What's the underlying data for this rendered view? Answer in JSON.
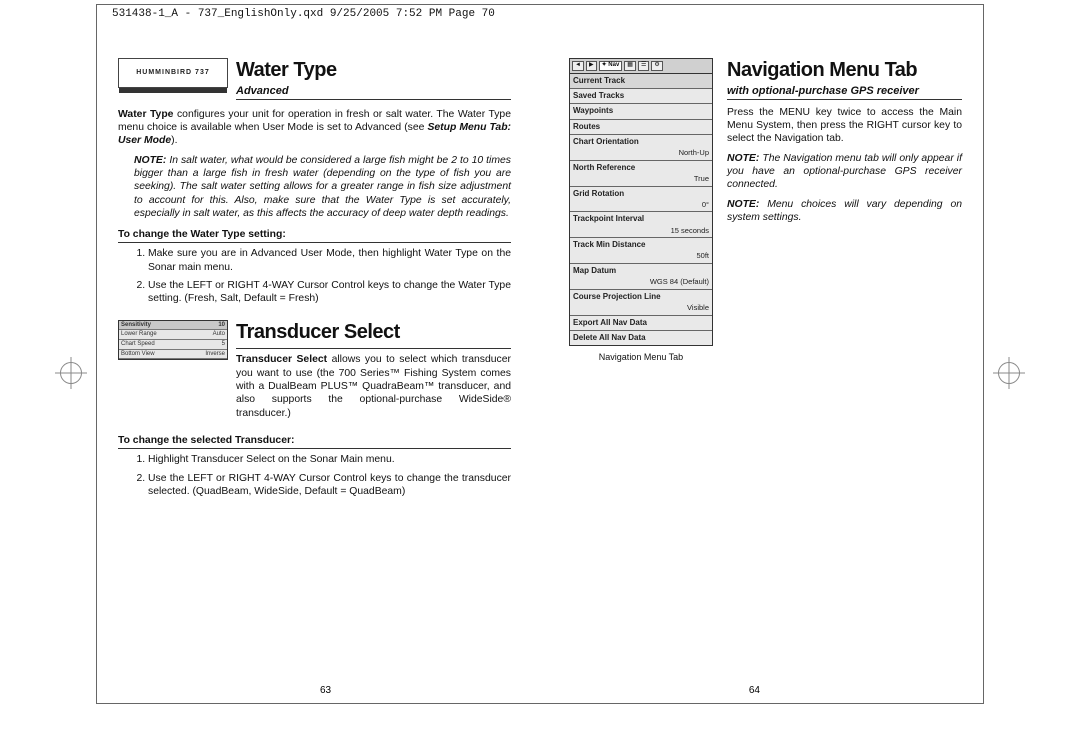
{
  "header_slug": "531438-1_A - 737_EnglishOnly.qxd  9/25/2005  7:52 PM  Page 70",
  "left": {
    "brand": "HUMMINBIRD 737",
    "section1": {
      "heading": "Water Type",
      "subhead": "Advanced",
      "intro_bold": "Water Type",
      "intro_rest": " configures your unit for operation in fresh or salt water. The Water Type menu choice is available when User Mode is set to Advanced (see ",
      "intro_ref": "Setup Menu Tab: User Mode",
      "intro_end": ").",
      "note_label": "NOTE:",
      "note_text": "  In salt water, what would be considered a large fish might be 2 to 10 times bigger than a large fish in fresh water (depending on the type of fish you are seeking).  The salt water setting allows for a greater range in fish size adjustment to account for this.  Also, make sure that the Water Type is set accurately, especially in salt water, as this affects the accuracy of deep water depth readings.",
      "instr_head": "To change the Water Type setting:",
      "steps": [
        "Make sure you are in Advanced User Mode, then highlight Water Type on the Sonar main menu.",
        "Use the LEFT or RIGHT 4-WAY Cursor Control keys to change the Water Type setting. (Fresh, Salt, Default = Fresh)"
      ]
    },
    "section2": {
      "heading": "Transducer Select",
      "menu_rows": [
        {
          "l": "Sensitivity",
          "r": "10"
        },
        {
          "l": "Lower Range",
          "r": "Auto"
        },
        {
          "l": "Chart Speed",
          "r": "5"
        },
        {
          "l": "Bottom View",
          "r": "Inverse"
        }
      ],
      "intro_bold": "Transducer Select",
      "intro_rest": " allows you to select which transducer you want to use (the 700 Series™ Fishing System comes with a DualBeam PLUS™ QuadraBeam™ transducer, and also supports the optional-purchase WideSide® transducer.)",
      "instr_head": "To change the selected Transducer:",
      "steps": [
        "Highlight Transducer Select on the Sonar Main menu.",
        "Use the LEFT or RIGHT 4-WAY Cursor Control keys to change the transducer selected. (QuadBeam, WideSide, Default = QuadBeam)"
      ]
    },
    "pagenum": "63"
  },
  "right": {
    "heading": "Navigation Menu Tab",
    "subhead": "with optional-purchase GPS receiver",
    "intro": "Press the MENU key twice to access the Main Menu System, then press the RIGHT cursor key to select the Navigation tab.",
    "note1_label": "NOTE:",
    "note1_text": " The Navigation menu tab will only appear if you have an optional-purchase GPS receiver connected.",
    "note2_label": "NOTE:",
    "note2_text": " Menu choices will vary depending on system settings.",
    "nav_tab_label": "✦ Nav",
    "nav_items": [
      {
        "label": "Current Track",
        "val": ""
      },
      {
        "label": "Saved Tracks",
        "val": ""
      },
      {
        "label": "Waypoints",
        "val": ""
      },
      {
        "label": "Routes",
        "val": ""
      },
      {
        "label": "Chart Orientation",
        "val": "North-Up"
      },
      {
        "label": "North Reference",
        "val": "True"
      },
      {
        "label": "Grid Rotation",
        "val": "0°"
      },
      {
        "label": "Trackpoint Interval",
        "val": "15 seconds"
      },
      {
        "label": "Track Min Distance",
        "val": "50ft"
      },
      {
        "label": "Map Datum",
        "val": "WGS 84 (Default)"
      },
      {
        "label": "Course Projection Line",
        "val": "Visible"
      },
      {
        "label": "Export All Nav Data",
        "val": ""
      },
      {
        "label": "Delete All Nav Data",
        "val": ""
      }
    ],
    "fig_caption": "Navigation Menu Tab",
    "pagenum": "64"
  }
}
